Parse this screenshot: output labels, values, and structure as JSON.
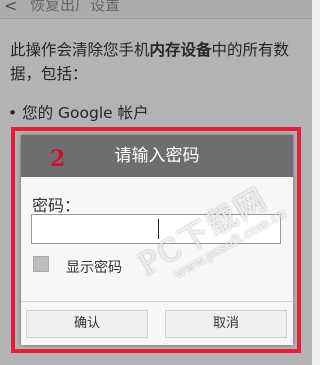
{
  "screen": {
    "back_glyph": "<",
    "title": "恢复出厂设置",
    "description_lines": [
      "此操作会清除您手机",
      "内存设备",
      "中的所有数据，包括："
    ],
    "bullet": "• 您的 Google 帐户"
  },
  "annotation": {
    "number": "2"
  },
  "dialog": {
    "title": "请输入密码",
    "password_label": "密码：",
    "password_value": "",
    "show_password_label": "显示密码",
    "show_password_checked": false,
    "ok_button": "确认",
    "cancel_button": "取消"
  },
  "watermark": {
    "brand": "PC下载网",
    "url": "www.pcsoft.com.cn"
  },
  "colors": {
    "highlight_border": "#e0203a",
    "dialog_title_bg": "#6e6e6e"
  }
}
